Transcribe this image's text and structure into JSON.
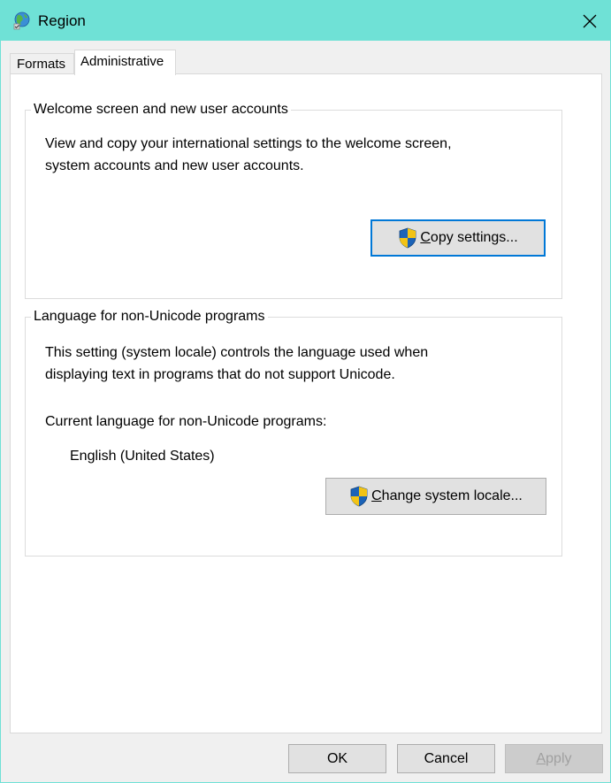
{
  "window": {
    "title": "Region",
    "accent": "#6fe1d6"
  },
  "tabs": [
    {
      "label": "Formats",
      "selected": false
    },
    {
      "label": "Administrative",
      "selected": true
    }
  ],
  "welcome_group": {
    "legend": "Welcome screen and new user accounts",
    "description_line1": "View and copy your international settings to the welcome screen,",
    "description_line2": "system accounts and new user accounts.",
    "copy_button": {
      "mnemonic": "C",
      "rest": "opy settings...",
      "icon": "uac-shield-icon"
    }
  },
  "locale_group": {
    "legend": "Language for non-Unicode programs",
    "description_line1": "This setting (system locale) controls the language used when",
    "description_line2": "displaying text in programs that do not support Unicode.",
    "current_label": "Current language for non-Unicode programs:",
    "current_value": "English (United States)",
    "change_button": {
      "mnemonic": "C",
      "rest": "hange system locale...",
      "icon": "uac-shield-icon"
    }
  },
  "footer": {
    "ok_label": "OK",
    "cancel_label": "Cancel",
    "apply_mnemonic": "A",
    "apply_rest": "pply",
    "apply_enabled": false
  }
}
